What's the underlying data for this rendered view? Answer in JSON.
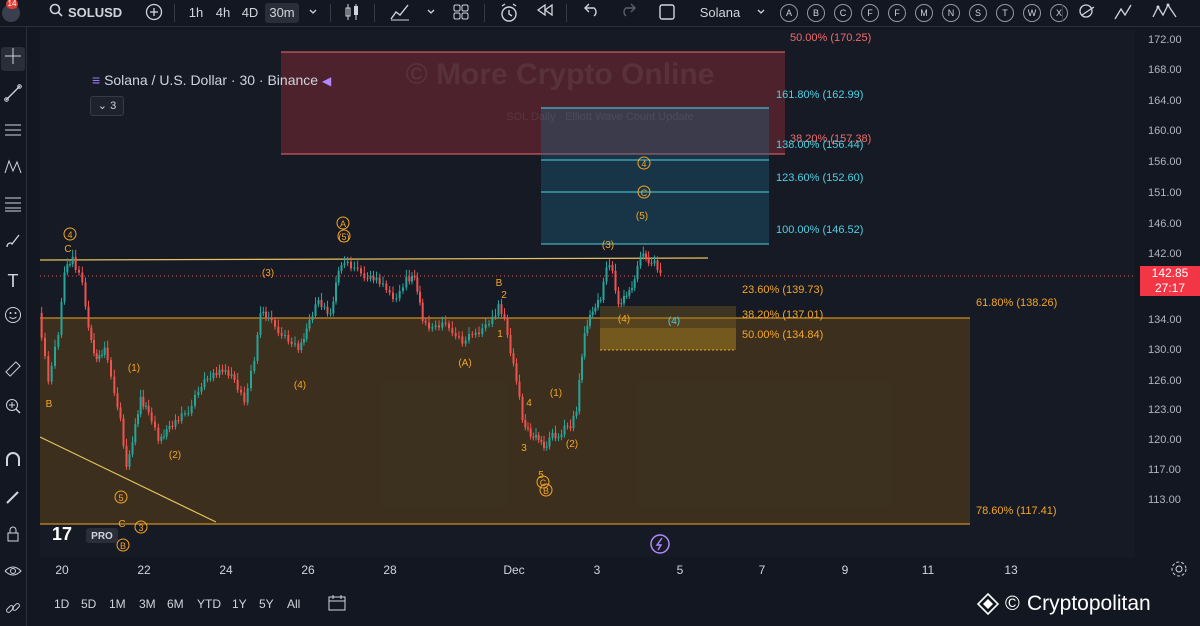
{
  "toolbar": {
    "symbol": "SOLUSD",
    "intervals": [
      "1h",
      "4h",
      "4D",
      "30m"
    ],
    "active_interval": "30m",
    "template_name": "Solana",
    "letters": [
      "A",
      "B",
      "C",
      "F",
      "F",
      "M",
      "N",
      "S",
      "T",
      "W",
      "X"
    ],
    "avatar_badge": "14"
  },
  "legend": {
    "title": "Solana / U.S. Dollar · 30 · Binance",
    "collapse_count": "3"
  },
  "watermark": {
    "text": "© More Crypto Online",
    "subtext": "SOL Daily · Elliott Wave Count Update"
  },
  "price_axis": {
    "ticks": [
      "172.00",
      "168.00",
      "164.00",
      "160.00",
      "156.00",
      "151.00",
      "146.00",
      "142.00",
      "138.00",
      "134.00",
      "130.00",
      "126.00",
      "123.00",
      "120.00",
      "117.00",
      "113.00"
    ],
    "current_price": "142.85",
    "countdown": "27:17"
  },
  "time_axis": [
    "20",
    "22",
    "24",
    "26",
    "28",
    "Dec",
    "3",
    "5",
    "7",
    "9",
    "11",
    "13"
  ],
  "fib_levels": [
    {
      "label": "50.00% (170.25)",
      "color": "#f06b6b"
    },
    {
      "label": "161.80% (162.99)",
      "color": "#4dd0e1"
    },
    {
      "label": "38.20% (157.38)",
      "color": "#f06b6b"
    },
    {
      "label": "138.00% (156.44)",
      "color": "#4dd0e1"
    },
    {
      "label": "123.60% (152.60)",
      "color": "#4dd0e1"
    },
    {
      "label": "100.00% (146.52)",
      "color": "#4dd0e1"
    },
    {
      "label": "23.60% (139.73)",
      "color": "#f5a623"
    },
    {
      "label": "61.80% (138.26)",
      "color": "#f5a623"
    },
    {
      "label": "38.20% (137.01)",
      "color": "#f5a623"
    },
    {
      "label": "50.00% (134.84)",
      "color": "#f5a623"
    },
    {
      "label": "78.60% (117.41)",
      "color": "#f5a623"
    }
  ],
  "wave_labels": [
    "4",
    "C",
    "B",
    "(1)",
    "(2)",
    "5",
    "C",
    "3",
    "B",
    "(3)",
    "(4)",
    "A",
    "(5)",
    "(A)",
    "B",
    "2",
    "1",
    "4",
    "3",
    "5",
    "C",
    "B",
    "(1)",
    "(2)",
    "(3)",
    "(4)",
    "(4)",
    "4",
    "C",
    "(5)"
  ],
  "bottom": {
    "ranges": [
      "1D",
      "5D",
      "1M",
      "3M",
      "6M",
      "YTD",
      "1Y",
      "5Y",
      "All"
    ],
    "brand": "Cryptopolitan",
    "logo_text": "PRO"
  },
  "colors": {
    "up": "#26a69a",
    "down": "#ef5350",
    "fib_orange": "#f5a623",
    "fib_cyan": "#4dd0e1",
    "fib_red": "#f06b6b"
  }
}
